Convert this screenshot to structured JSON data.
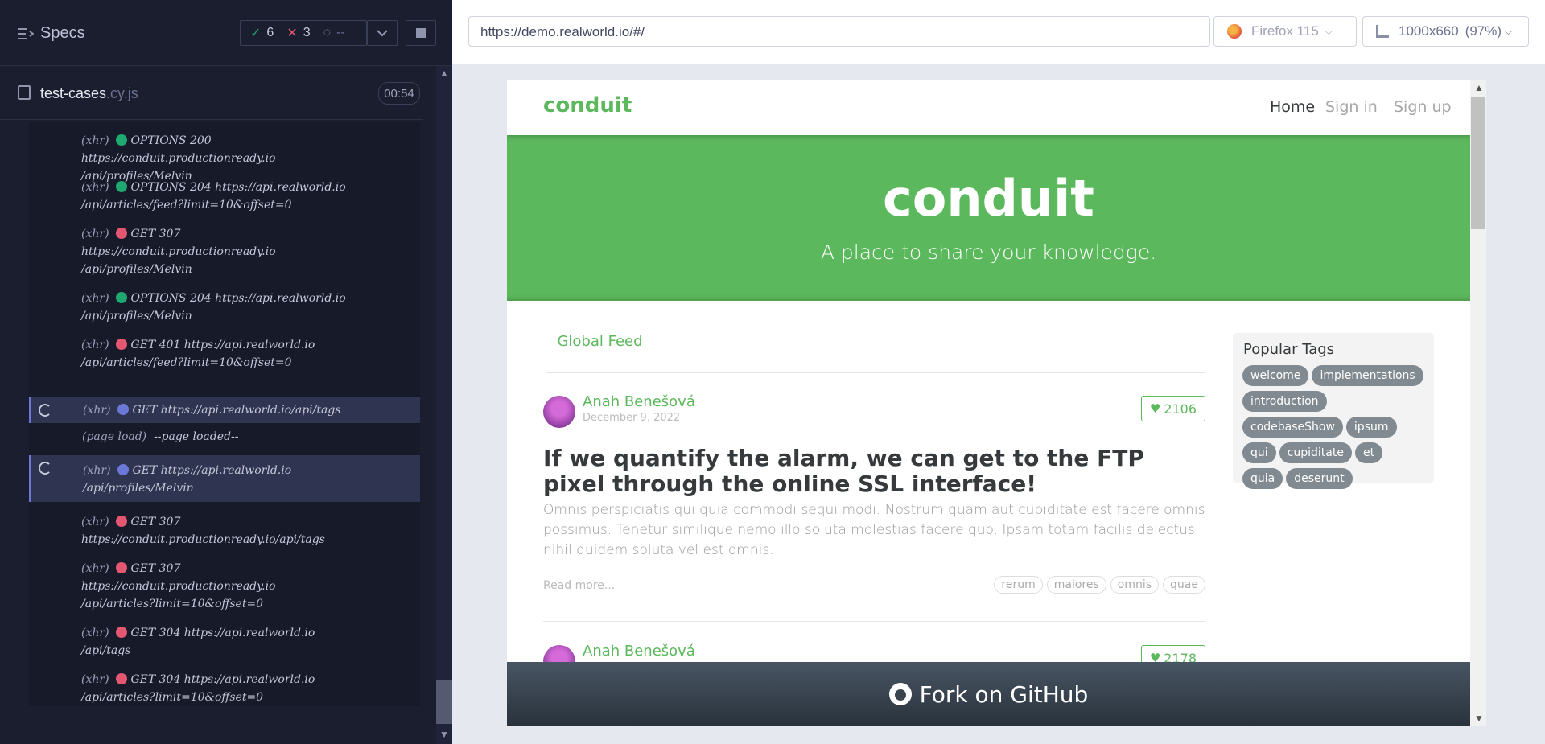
{
  "reporter": {
    "specs_label": "Specs",
    "passed": "6",
    "failed": "3",
    "pending": "--",
    "spec_name": "test-cases",
    "spec_ext": ".cy.js",
    "duration": "00:54",
    "log": [
      {
        "type": "(xhr)",
        "status": "green",
        "text": "OPTIONS 200",
        "line2": "https://conduit.productionready.io",
        "line3": "/api/profiles/Melvin"
      },
      {
        "type": "(xhr)",
        "status": "green",
        "text": "OPTIONS 204 https://api.realworld.io",
        "line2": "/api/articles/feed?limit=10&offset=0"
      },
      {
        "type": "(xhr)",
        "status": "red",
        "text": "GET 307",
        "line2": "https://conduit.productionready.io",
        "line3": "/api/profiles/Melvin"
      },
      {
        "type": "(xhr)",
        "status": "green",
        "text": "OPTIONS 204 https://api.realworld.io",
        "line2": "/api/profiles/Melvin"
      },
      {
        "type": "(xhr)",
        "status": "red",
        "text": "GET 401 https://api.realworld.io",
        "line2": "/api/articles/feed?limit=10&offset=0"
      },
      {
        "type": "(xhr)",
        "status": "blue",
        "text": "GET https://api.realworld.io/api/tags",
        "active": true
      },
      {
        "type": "(page load)",
        "status": "none",
        "text": "--page loaded--"
      },
      {
        "type": "(xhr)",
        "status": "blue",
        "text": "GET https://api.realworld.io",
        "line2": "/api/profiles/Melvin",
        "active": true
      },
      {
        "type": "(xhr)",
        "status": "red",
        "text": "GET 307",
        "line2": "https://conduit.productionready.io/api/tags"
      },
      {
        "type": "(xhr)",
        "status": "red",
        "text": "GET 307",
        "line2": "https://conduit.productionready.io",
        "line3": "/api/articles?limit=10&offset=0"
      },
      {
        "type": "(xhr)",
        "status": "red",
        "text": "GET 304 https://api.realworld.io",
        "line2": "/api/tags"
      },
      {
        "type": "(xhr)",
        "status": "red",
        "text": "GET 304 https://api.realworld.io",
        "line2": "/api/articles?limit=10&offset=0"
      }
    ]
  },
  "aut_header": {
    "url": "https://demo.realworld.io/#/",
    "browser": "Firefox 115",
    "viewport": "1000x660",
    "zoom": "(97%)"
  },
  "app": {
    "brand": "conduit",
    "nav": [
      "Home",
      "Sign in",
      "Sign up"
    ],
    "banner_title": "conduit",
    "banner_subtitle": "A place to share your knowledge.",
    "feed_tab": "Global Feed",
    "articles": [
      {
        "author": "Anah Benešová",
        "date": "December 9, 2022",
        "likes": "2106",
        "title": "If we quantify the alarm, we can get to the FTP pixel through the online SSL interface!",
        "description": "Omnis perspiciatis qui quia commodi sequi modi. Nostrum quam aut cupiditate est facere omnis possimus. Tenetur similique nemo illo soluta molestias facere quo. Ipsam totam facilis delectus nihil quidem soluta vel est omnis.",
        "read_more": "Read more...",
        "tags": [
          "rerum",
          "maiores",
          "omnis",
          "quae"
        ]
      },
      {
        "author": "Anah Benešová",
        "likes": "2178"
      }
    ],
    "popular_tags_title": "Popular Tags",
    "popular_tags": [
      "welcome",
      "implementations",
      "introduction",
      "codebaseShow",
      "ipsum",
      "qui",
      "cupiditate",
      "et",
      "quia",
      "deserunt"
    ],
    "fork_label": "Fork on GitHub"
  },
  "colors": {
    "brand_green": "#5cb85c",
    "reporter_bg": "#1b1e2e",
    "pass": "#1fa971",
    "fail": "#e45770",
    "active_blue": "#6b78d8"
  }
}
